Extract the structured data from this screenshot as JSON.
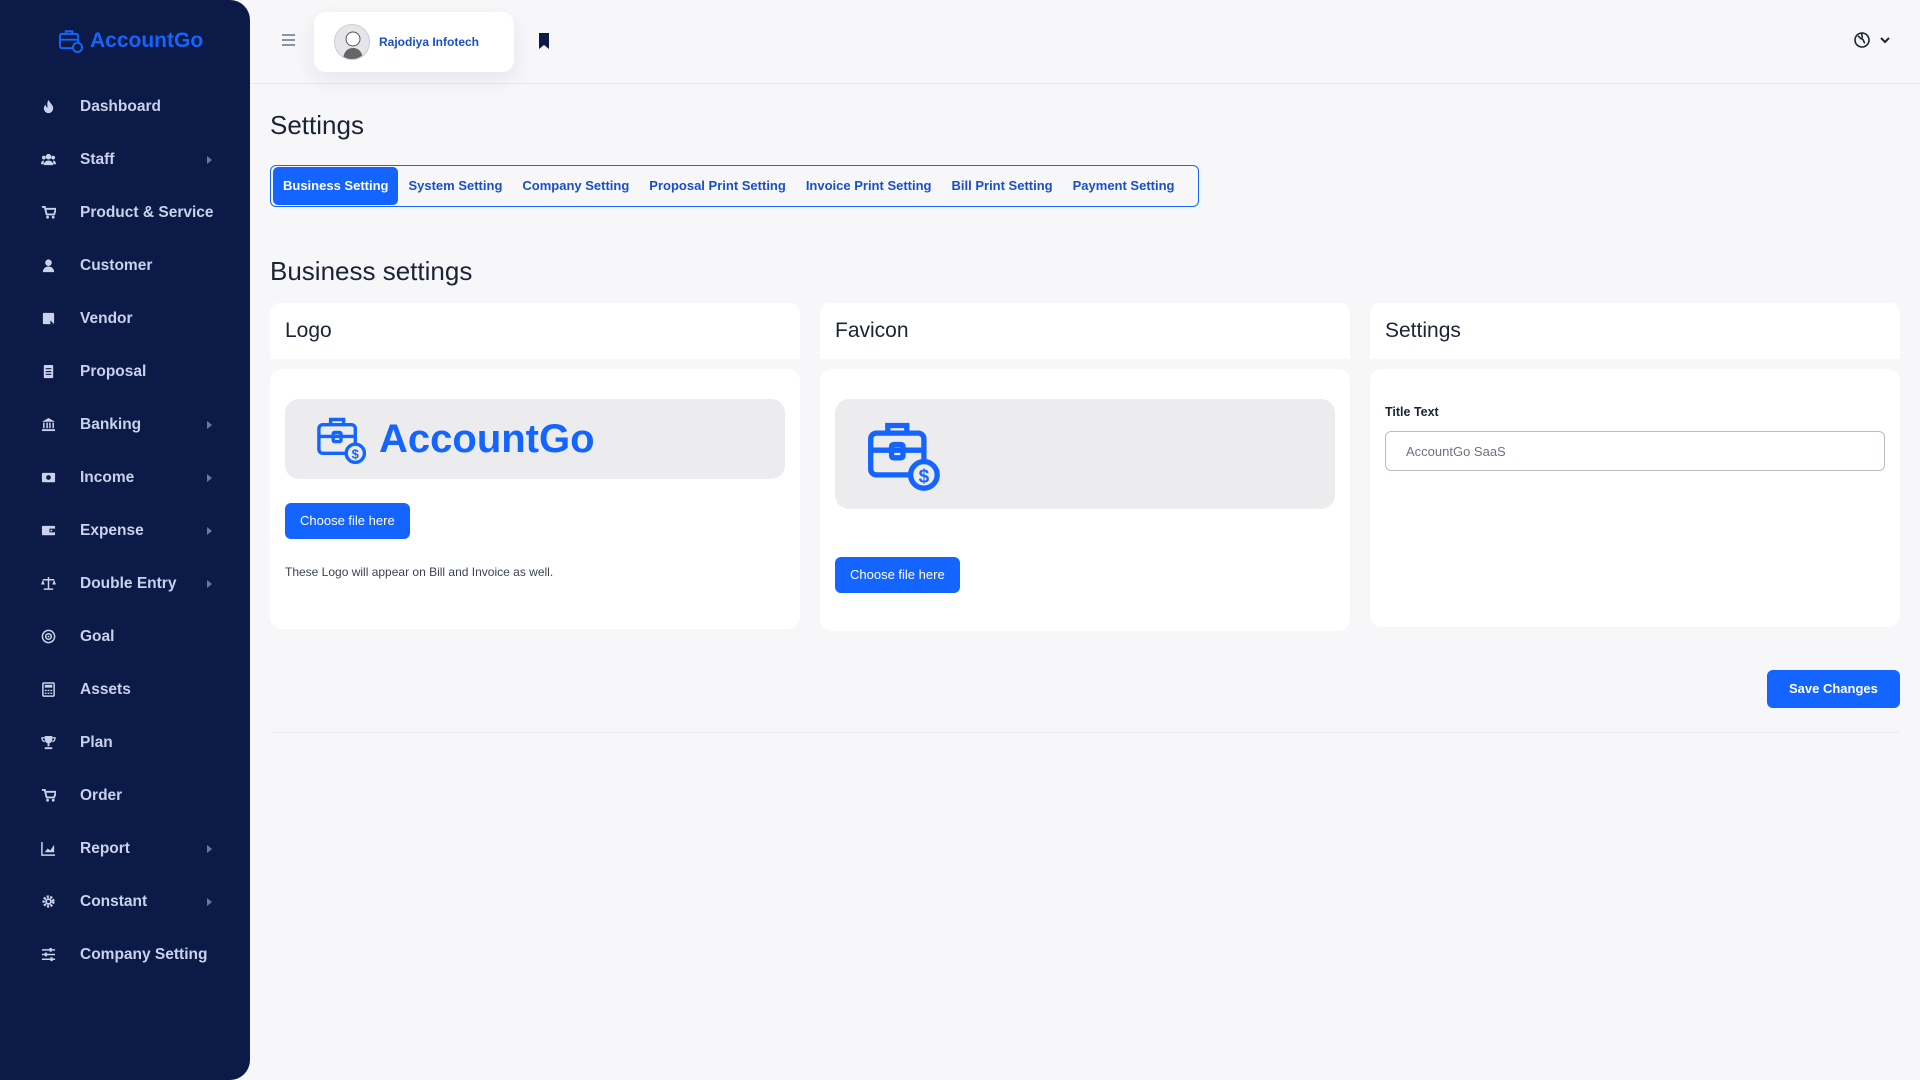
{
  "brand": {
    "name": "AccountGo"
  },
  "colors": {
    "accent": "#1464ff",
    "sidebar_bg": "#0c1a47",
    "page_bg": "#f7f7fa"
  },
  "sidebar": {
    "items": [
      {
        "label": "Dashboard",
        "icon": "dashboard-icon",
        "submenu": false
      },
      {
        "label": "Staff",
        "icon": "users-icon",
        "submenu": true
      },
      {
        "label": "Product & Service",
        "icon": "cart-icon",
        "submenu": false
      },
      {
        "label": "Customer",
        "icon": "customer-icon",
        "submenu": false
      },
      {
        "label": "Vendor",
        "icon": "vendor-icon",
        "submenu": false
      },
      {
        "label": "Proposal",
        "icon": "document-icon",
        "submenu": false
      },
      {
        "label": "Banking",
        "icon": "bank-icon",
        "submenu": true
      },
      {
        "label": "Income",
        "icon": "money-icon",
        "submenu": true
      },
      {
        "label": "Expense",
        "icon": "wallet-icon",
        "submenu": true
      },
      {
        "label": "Double Entry",
        "icon": "scale-icon",
        "submenu": true
      },
      {
        "label": "Goal",
        "icon": "target-icon",
        "submenu": false
      },
      {
        "label": "Assets",
        "icon": "calculator-icon",
        "submenu": false
      },
      {
        "label": "Plan",
        "icon": "trophy-icon",
        "submenu": false
      },
      {
        "label": "Order",
        "icon": "cart-plus-icon",
        "submenu": false
      },
      {
        "label": "Report",
        "icon": "chart-icon",
        "submenu": true
      },
      {
        "label": "Constant",
        "icon": "gear-icon",
        "submenu": true
      },
      {
        "label": "Company Setting",
        "icon": "sliders-icon",
        "submenu": false
      }
    ]
  },
  "header": {
    "user_name": "Rajodiya Infotech"
  },
  "page": {
    "title": "Settings",
    "tabs": [
      {
        "label": "Business Setting",
        "active": true
      },
      {
        "label": "System Setting",
        "active": false
      },
      {
        "label": "Company Setting",
        "active": false
      },
      {
        "label": "Proposal Print Setting",
        "active": false
      },
      {
        "label": "Invoice Print Setting",
        "active": false
      },
      {
        "label": "Bill Print Setting",
        "active": false
      },
      {
        "label": "Payment Setting",
        "active": false
      }
    ],
    "section_title": "Business settings",
    "logo_card": {
      "title": "Logo",
      "logo_text": "AccountGo",
      "choose_label": "Choose file here",
      "note": "These Logo will appear on Bill and Invoice as well."
    },
    "favicon_card": {
      "title": "Favicon",
      "choose_label": "Choose file here"
    },
    "settings_card": {
      "title": "Settings",
      "title_text_label": "Title Text",
      "title_text_value": "AccountGo SaaS"
    },
    "save_label": "Save Changes"
  }
}
